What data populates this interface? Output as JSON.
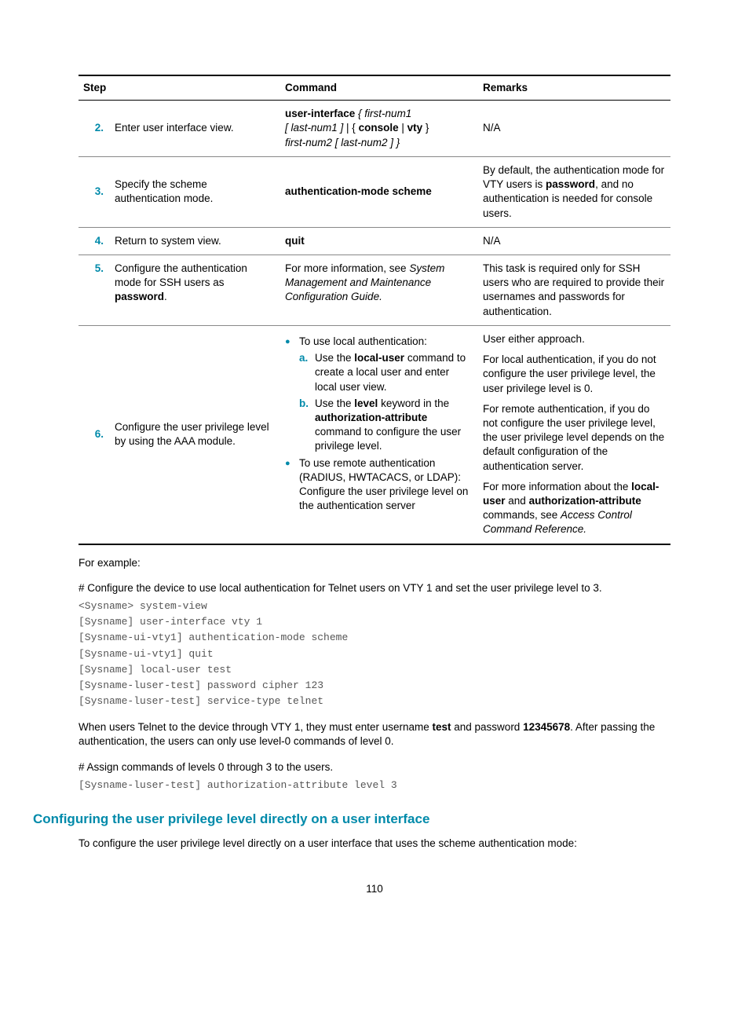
{
  "table": {
    "headers": {
      "step": "Step",
      "command": "Command",
      "remarks": "Remarks"
    },
    "rows": [
      {
        "num": "2.",
        "step": "Enter user interface view.",
        "cmd": {
          "b1": "user-interface",
          "i1": " { first-num1 ",
          "i2": "[ last-num1 ] ",
          "t1": "| { ",
          "b2": "console",
          "t2": " | ",
          "b3": "vty",
          "t3": " } ",
          "i3": "first-num2 [ last-num2 ] }"
        },
        "remarks": "N/A"
      },
      {
        "num": "3.",
        "step": "Specify the scheme authentication mode.",
        "cmd_bold": "authentication-mode scheme",
        "remarks": {
          "t1": "By default, the authentication mode for VTY users is ",
          "b1": "password",
          "t2": ", and no authentication is needed for console users."
        }
      },
      {
        "num": "4.",
        "step": "Return to system view.",
        "cmd_bold": "quit",
        "remarks": "N/A"
      },
      {
        "num": "5.",
        "step": {
          "t1": "Configure the authentication mode for SSH users as ",
          "b1": "password",
          "t2": "."
        },
        "cmd": {
          "t1": "For more information, see ",
          "i1": "System Management and Maintenance Configuration Guide."
        },
        "remarks": "This task is required only for SSH users who are required to provide their usernames and passwords for authentication."
      },
      {
        "num": "6.",
        "step": "Configure the user privilege level by using the AAA module.",
        "cmd_bullets": {
          "b1": "To use local authentication:",
          "a_pre": "Use the ",
          "a_bold": "local-user",
          "a_post": " command to create a local user and enter local user view.",
          "b_pre": "Use the ",
          "b_bold1": "level",
          "b_mid": " keyword in the ",
          "b_bold2": "authorization-attribute",
          "b_post": " command to configure the user privilege level.",
          "b2_line1": "To use remote authentication (RADIUS, HWTACACS, or LDAP):",
          "b2_line2": "Configure the user privilege level on the authentication server"
        },
        "remarks": {
          "p1": "User either approach.",
          "p2": "For local authentication, if you do not configure the user privilege level, the user privilege level is 0.",
          "p3": "For remote authentication, if you do not configure the user privilege level, the user privilege level depends on the default configuration of the authentication server.",
          "p4_t1": "For more information about the ",
          "p4_b1": "local-user",
          "p4_t2": " and ",
          "p4_b2": "authorization-attribute",
          "p4_t3": " commands, see ",
          "p4_i1": "Access Control Command Reference."
        }
      }
    ]
  },
  "para1": "For example:",
  "para2": "# Configure the device to use local authentication for Telnet users on VTY 1 and set the user privilege level to 3.",
  "code1": "<Sysname> system-view\n[Sysname] user-interface vty 1\n[Sysname-ui-vty1] authentication-mode scheme\n[Sysname-ui-vty1] quit\n[Sysname] local-user test\n[Sysname-luser-test] password cipher 123\n[Sysname-luser-test] service-type telnet",
  "para3": {
    "t1": "When users Telnet to the device through VTY 1, they must enter username ",
    "b1": "test",
    "t2": " and password ",
    "b2": "12345678",
    "t3": ". After passing the authentication, the users can only use level-0 commands of level 0."
  },
  "para4": "# Assign commands of levels 0 through 3 to the users.",
  "code2": "[Sysname-luser-test] authorization-attribute level 3",
  "heading": "Configuring the user privilege level directly on a user interface",
  "para5": "To configure the user privilege level directly on a user interface that uses the scheme authentication mode:",
  "page": "110"
}
